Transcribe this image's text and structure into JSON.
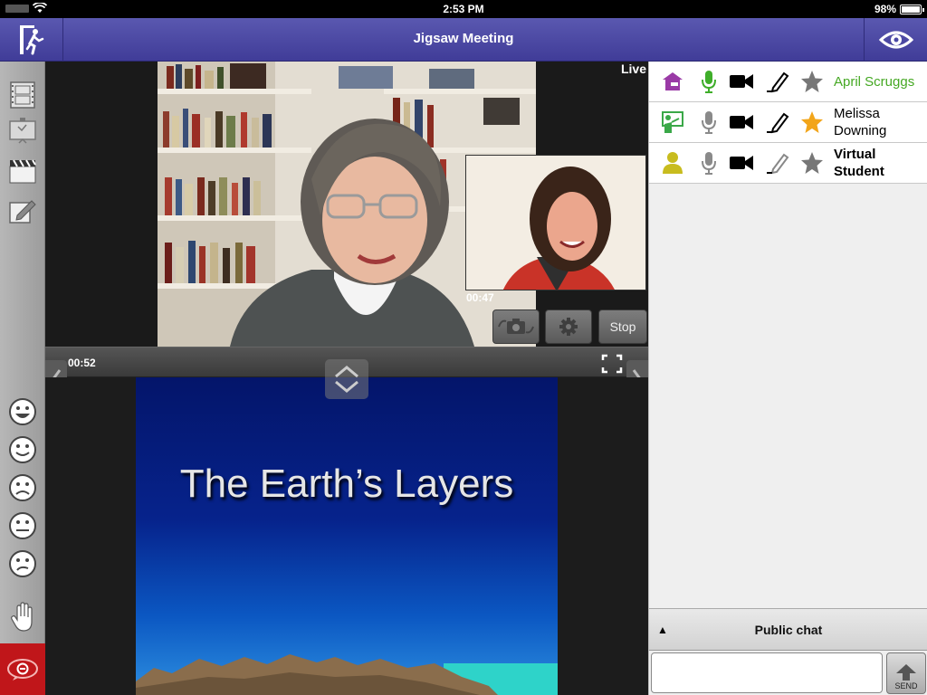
{
  "status_bar": {
    "time": "2:53 PM",
    "battery": "98%",
    "battery_level": 0.98
  },
  "header": {
    "title": "Jigsaw Meeting",
    "exit_icon": "exit-door-icon",
    "view_icon": "eye-icon"
  },
  "left_toolbar": {
    "tools": [
      "film-strip-icon",
      "presentation-icon",
      "clapperboard-icon",
      "edit-note-icon"
    ],
    "emotions": [
      "happy-face-icon",
      "smile-face-icon",
      "sad-face-icon",
      "neutral-face-icon",
      "confused-face-icon"
    ],
    "raise_hand_icon": "raise-hand-icon",
    "chat_toggle_icon": "chat-bubble-icon"
  },
  "video": {
    "live_label": "Live",
    "main_timer": "00:52",
    "pip_timer": "00:47",
    "stop_label": "Stop"
  },
  "slide": {
    "title": "The Earth’s Layers"
  },
  "participants": [
    {
      "name": "April Scruggs",
      "name_color": "#45a823",
      "role_icon": "presenter-icon",
      "mic_active": true,
      "star_color": "#777777"
    },
    {
      "name": "Melissa Downing",
      "name_color": "#000000",
      "role_icon": "teacher-icon",
      "mic_active": false,
      "star_color": "#f2a51a"
    },
    {
      "name": "Virtual Student",
      "name_color": "#000000",
      "role_icon": "student-icon",
      "mic_active": false,
      "star_color": "#777777"
    }
  ],
  "chat": {
    "header_label": "Public chat",
    "input_value": "",
    "send_label": "SEND"
  },
  "colors": {
    "header": "#4a47a5",
    "accent_green": "#45a823",
    "chat_toggle": "#c0161a"
  }
}
